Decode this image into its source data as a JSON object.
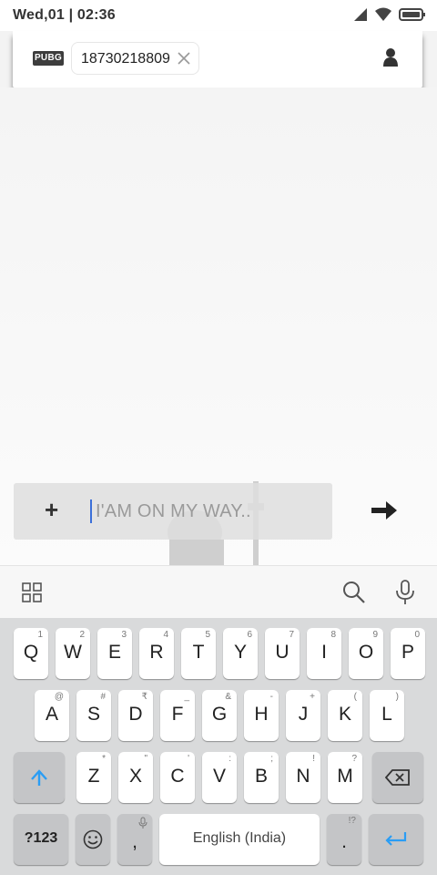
{
  "status_bar": {
    "time": "Wed,01 | 02:36"
  },
  "header": {
    "logo_text": "PUBG",
    "chip_text": "18730218809"
  },
  "compose": {
    "input_text": "I'AM ON MY WAY.."
  },
  "keyboard": {
    "row1": [
      {
        "k": "Q",
        "h": "1"
      },
      {
        "k": "W",
        "h": "2"
      },
      {
        "k": "E",
        "h": "3"
      },
      {
        "k": "R",
        "h": "4"
      },
      {
        "k": "T",
        "h": "5"
      },
      {
        "k": "Y",
        "h": "6"
      },
      {
        "k": "U",
        "h": "7"
      },
      {
        "k": "I",
        "h": "8"
      },
      {
        "k": "O",
        "h": "9"
      },
      {
        "k": "P",
        "h": "0"
      }
    ],
    "row2": [
      {
        "k": "A",
        "h": "@"
      },
      {
        "k": "S",
        "h": "#"
      },
      {
        "k": "D",
        "h": "₹"
      },
      {
        "k": "F",
        "h": "_"
      },
      {
        "k": "G",
        "h": "&"
      },
      {
        "k": "H",
        "h": "-"
      },
      {
        "k": "J",
        "h": "+"
      },
      {
        "k": "K",
        "h": "("
      },
      {
        "k": "L",
        "h": ")"
      }
    ],
    "row3": [
      {
        "k": "Z",
        "h": "*"
      },
      {
        "k": "X",
        "h": "\""
      },
      {
        "k": "C",
        "h": "'"
      },
      {
        "k": "V",
        "h": ":"
      },
      {
        "k": "B",
        "h": ";"
      },
      {
        "k": "N",
        "h": "!"
      },
      {
        "k": "M",
        "h": "?"
      }
    ],
    "symbols_label": "?123",
    "comma_label": ",",
    "space_label": "English (India)",
    "period_label": ".",
    "period_hint": "!?"
  },
  "colors": {
    "accent": "#2a9df4",
    "caret": "#3b6fd9"
  }
}
